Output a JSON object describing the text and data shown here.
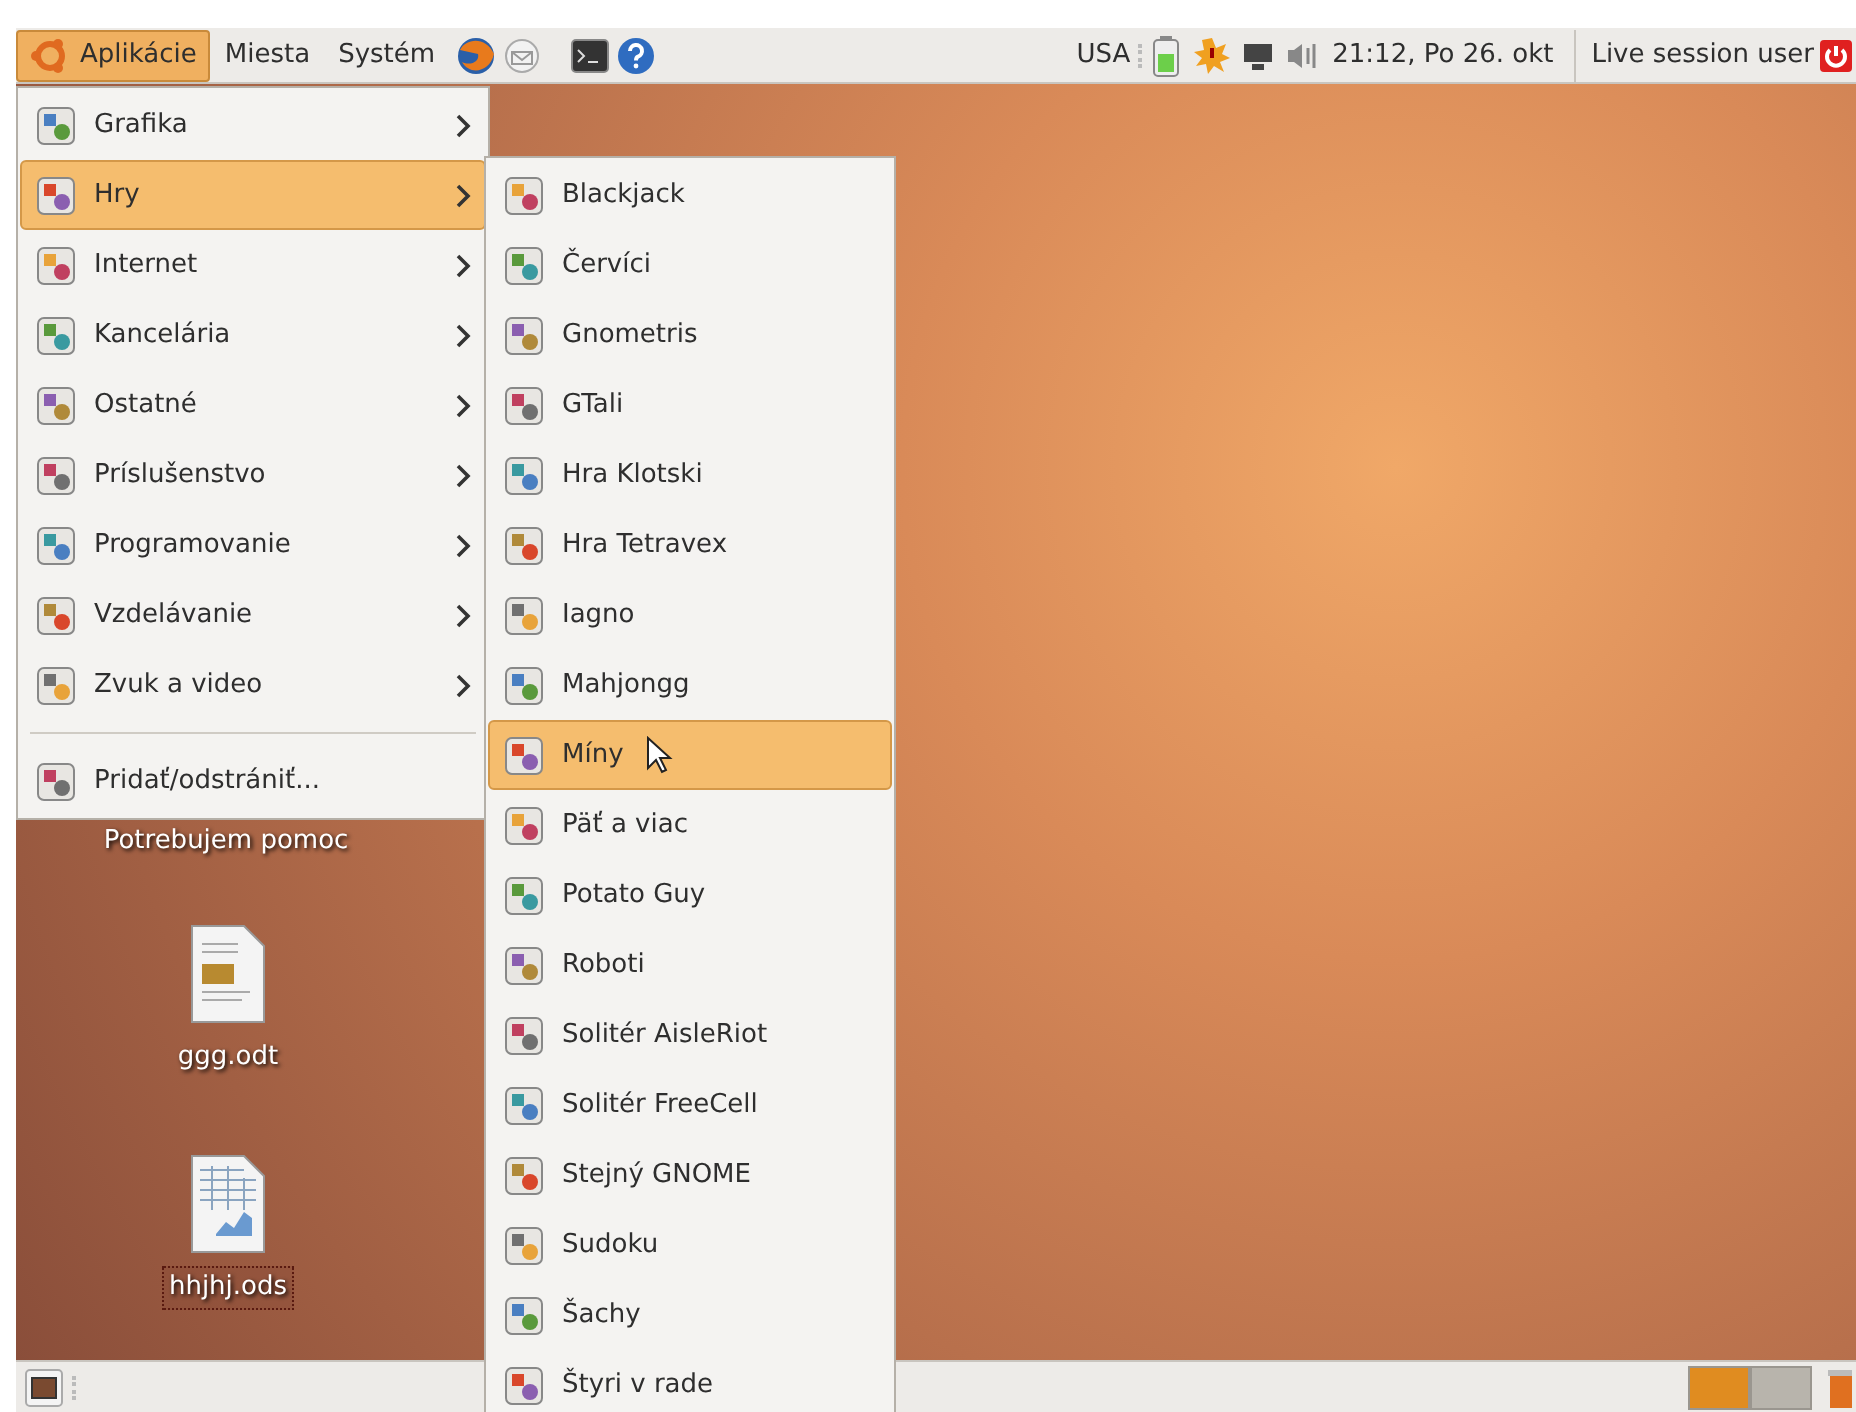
{
  "top_panel": {
    "menus": [
      {
        "label": "Aplikácie",
        "selected": true
      },
      {
        "label": "Miesta",
        "selected": false
      },
      {
        "label": "Systém",
        "selected": false
      }
    ],
    "keyboard_layout": "USA",
    "clock": "21:12, Po 26. okt",
    "user": "Live session user"
  },
  "applications_menu": {
    "items": [
      {
        "label": "Grafika",
        "selected": false,
        "submenu": true
      },
      {
        "label": "Hry",
        "selected": true,
        "submenu": true
      },
      {
        "label": "Internet",
        "selected": false,
        "submenu": true
      },
      {
        "label": "Kancelária",
        "selected": false,
        "submenu": true
      },
      {
        "label": "Ostatné",
        "selected": false,
        "submenu": true
      },
      {
        "label": "Príslušenstvo",
        "selected": false,
        "submenu": true
      },
      {
        "label": "Programovanie",
        "selected": false,
        "submenu": true
      },
      {
        "label": "Vzdelávanie",
        "selected": false,
        "submenu": true
      },
      {
        "label": "Zvuk a video",
        "selected": false,
        "submenu": true
      }
    ],
    "footer_items": [
      {
        "label": "Pridať/odstrániť...",
        "selected": false,
        "submenu": false
      }
    ]
  },
  "games_submenu": {
    "items": [
      {
        "label": "Blackjack",
        "selected": false
      },
      {
        "label": "Červíci",
        "selected": false
      },
      {
        "label": "Gnometris",
        "selected": false
      },
      {
        "label": "GTali",
        "selected": false
      },
      {
        "label": "Hra Klotski",
        "selected": false
      },
      {
        "label": "Hra Tetravex",
        "selected": false
      },
      {
        "label": "Iagno",
        "selected": false
      },
      {
        "label": "Mahjongg",
        "selected": false
      },
      {
        "label": "Míny",
        "selected": true
      },
      {
        "label": "Päť a viac",
        "selected": false
      },
      {
        "label": "Potato Guy",
        "selected": false
      },
      {
        "label": "Roboti",
        "selected": false
      },
      {
        "label": "Solitér AisleRiot",
        "selected": false
      },
      {
        "label": "Solitér FreeCell",
        "selected": false
      },
      {
        "label": "Stejný GNOME",
        "selected": false
      },
      {
        "label": "Sudoku",
        "selected": false
      },
      {
        "label": "Šachy",
        "selected": false
      },
      {
        "label": "Štyri v rade",
        "selected": false
      }
    ]
  },
  "desktop": {
    "icons": [
      {
        "label": "Potrebujem pomoc",
        "kind": "partial",
        "selected": false
      },
      {
        "label": "ggg.odt",
        "kind": "document",
        "selected": false
      },
      {
        "label": "hhjhj.ods",
        "kind": "spreadsheet",
        "selected": true
      }
    ]
  },
  "bottom_panel": {
    "workspaces": [
      {
        "selected": true
      },
      {
        "selected": false
      }
    ]
  }
}
